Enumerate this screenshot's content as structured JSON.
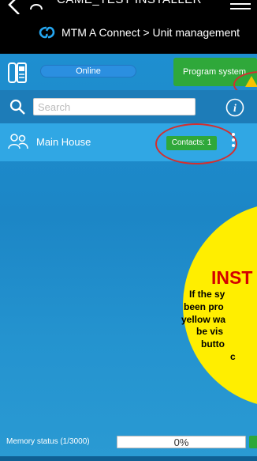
{
  "header": {
    "cut_title": "CAME_TEST INSTALLER",
    "breadcrumb": "MTM A Connect > Unit management"
  },
  "status": {
    "online_label": "Online",
    "program_button_label": "Program system"
  },
  "search": {
    "placeholder": "Search"
  },
  "units": [
    {
      "name": "Main House",
      "contacts_label": "Contacts: 1"
    }
  ],
  "callout": {
    "title": "INST",
    "lines": [
      "If the sy",
      "been pro",
      "yellow wa",
      "be vis",
      "butto",
      "c"
    ]
  },
  "memory": {
    "label": "Memory status (1/3000)",
    "percent_label": "0%",
    "fill_fraction": 0.0
  },
  "colors": {
    "accent_green": "#2fa83a",
    "panel_blue": "#1e8fd0",
    "row_blue": "#30a7e4",
    "annotation_red": "#d32f2f",
    "callout_yellow": "#ffee00",
    "callout_red": "#d40000"
  },
  "icons": {
    "back": "chevron-left-icon",
    "user": "user-icon",
    "menu": "hamburger-menu-icon",
    "logo": "came-connect-logo-icon",
    "device": "intercom-device-icon",
    "warning": "warning-triangle-icon",
    "search": "search-icon",
    "info": "info-icon",
    "users": "users-icon",
    "more": "kebab-menu-icon"
  }
}
